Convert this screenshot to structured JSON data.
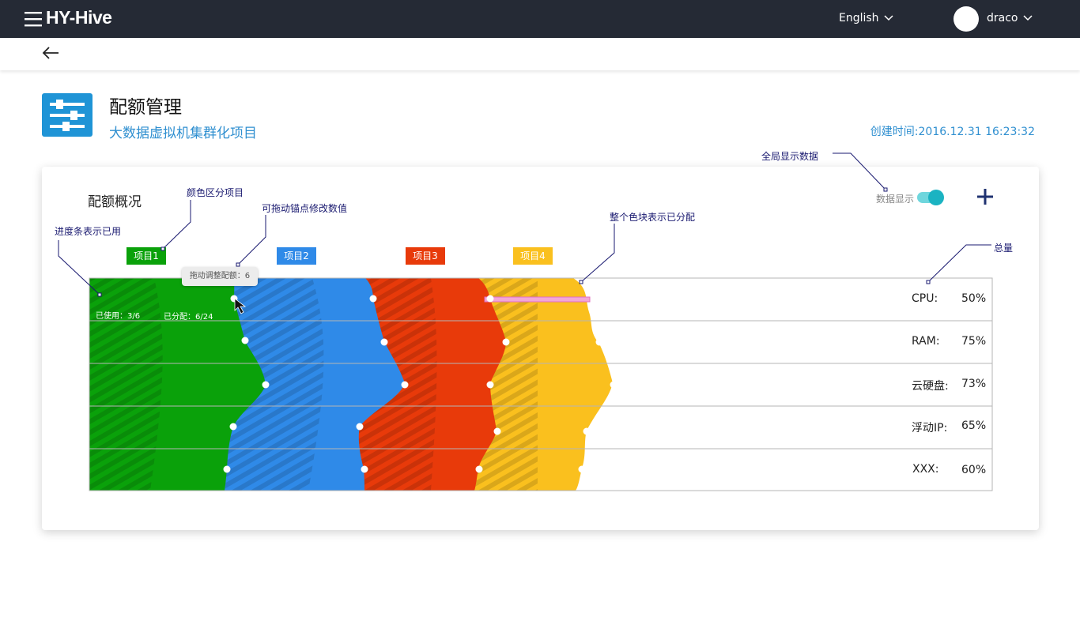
{
  "header": {
    "logo": "HY-Hive",
    "language": "English",
    "user": "draco"
  },
  "page": {
    "title": "配额管理",
    "subtitle": "大数据虚拟机集群化项目",
    "created": "创建时间:2016.12.31  16:23:32"
  },
  "card": {
    "title": "配额概况",
    "toggle_label": "数据显示",
    "toggle_on": true
  },
  "annotations": {
    "color_projects": "颜色区分项目",
    "drag_anchor": "可拖动锚点修改数值",
    "progress_used": "进度条表示已用",
    "whole_block": "整个色块表示已分配",
    "global_display": "全局显示数据",
    "total": "总量"
  },
  "tooltip": "拖动调整配额：6",
  "usage": {
    "used": "已使用：3/6",
    "allocated": "已分配：6/24"
  },
  "projects": [
    {
      "label": "项目1",
      "color": "#0aa10a"
    },
    {
      "label": "项目2",
      "color": "#2f8ae8"
    },
    {
      "label": "项目3",
      "color": "#e83a0a"
    },
    {
      "label": "项目4",
      "color": "#fac01e"
    }
  ],
  "resources": [
    {
      "name": "CPU:",
      "percent": "50%"
    },
    {
      "name": "RAM:",
      "percent": "75%"
    },
    {
      "name": "云硬盘:",
      "percent": "73%"
    },
    {
      "name": "浮动IP:",
      "percent": "65%"
    },
    {
      "name": "XXX:",
      "percent": "60%"
    }
  ],
  "colors": {
    "topbar": "#252a35",
    "accent": "#2f8fd0",
    "toggle": "#1bb3c2",
    "annotation": "#1a1a70"
  }
}
